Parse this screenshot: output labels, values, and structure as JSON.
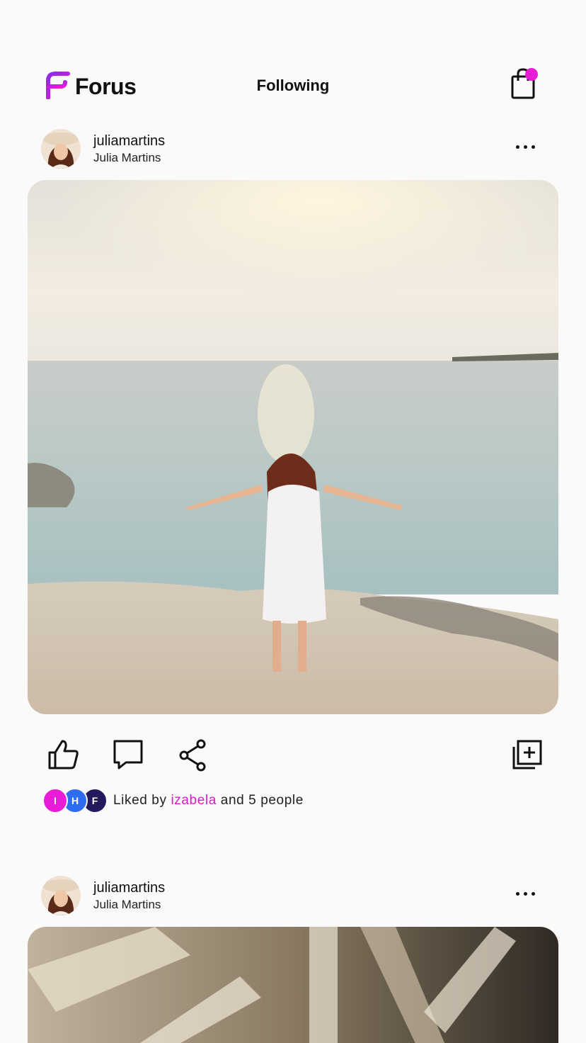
{
  "app": {
    "name": "Forus",
    "title": "Following",
    "accent": "#e81bd6"
  },
  "posts": [
    {
      "username": "juliamartins",
      "fullname": "Julia Martins"
    },
    {
      "username": "juliamartins",
      "fullname": "Julia Martins"
    }
  ],
  "likes": {
    "prefix": "Liked by",
    "user": "izabela",
    "suffix": "and 5 people",
    "avatars": [
      "I",
      "H",
      "F"
    ]
  },
  "icons": {
    "logo": "forus-logo-icon",
    "bag": "shopping-bag-icon",
    "more": "more-dots-icon",
    "like": "thumbs-up-icon",
    "comment": "comment-icon",
    "share": "share-icon",
    "save": "add-to-collection-icon"
  }
}
